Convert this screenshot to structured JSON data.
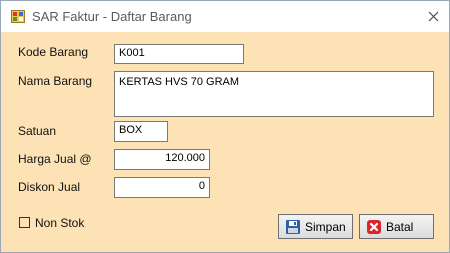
{
  "window": {
    "title": "SAR Faktur - Daftar Barang"
  },
  "form": {
    "kode_label": "Kode Barang",
    "kode_value": "K001",
    "nama_label": "Nama Barang",
    "nama_value": "KERTAS HVS 70 GRAM",
    "satuan_label": "Satuan",
    "satuan_value": "BOX",
    "harga_label": "Harga Jual @",
    "harga_value": "120.000",
    "diskon_label": "Diskon Jual",
    "diskon_value": "0",
    "nonstok_label": "Non Stok",
    "nonstok_checked": false
  },
  "buttons": {
    "simpan_label": "Simpan",
    "batal_label": "Batal"
  },
  "colors": {
    "form_background": "#fde2b5",
    "titlebar": "#ffffff",
    "batal_icon": "#d9262c",
    "simpan_icon": "#2f5fa8"
  }
}
